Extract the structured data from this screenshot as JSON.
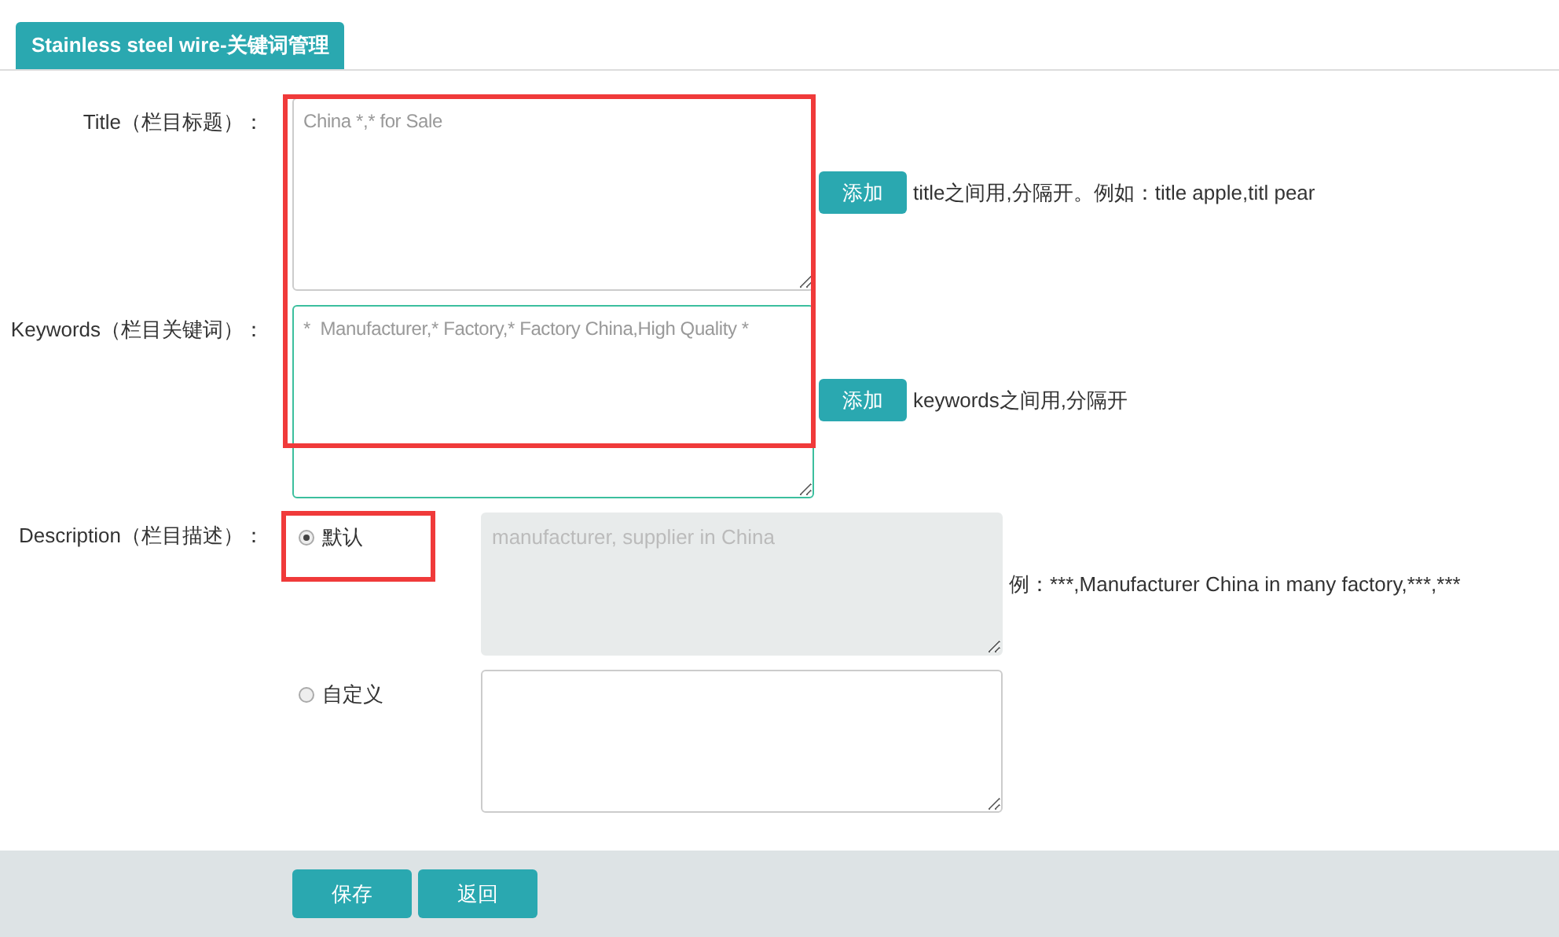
{
  "tab": {
    "label": "Stainless steel wire-关键词管理",
    "selected": true
  },
  "fields": [
    {
      "label": "Title（栏目标题）：",
      "placeholder": "China *,* for Sale",
      "focused": false,
      "button": "添加",
      "hint": "title之间用,分隔开。例如：title apple,titl pear"
    },
    {
      "label": "Keywords（栏目关键词）：",
      "placeholder": "*  Manufacturer,* Factory,* Factory China,High Quality *",
      "focused": true,
      "button": "添加",
      "hint": "keywords之间用,分隔开"
    }
  ],
  "description": {
    "label": "Description（栏目描述）：",
    "hint": "例：***,Manufacturer China in many factory,***,***",
    "options": [
      {
        "label": "默认",
        "selected": true,
        "disabled": true,
        "placeholder": "manufacturer, supplier in China"
      },
      {
        "label": "自定义",
        "selected": false,
        "disabled": false
      }
    ]
  },
  "buttons": [
    "保存",
    "返回"
  ]
}
